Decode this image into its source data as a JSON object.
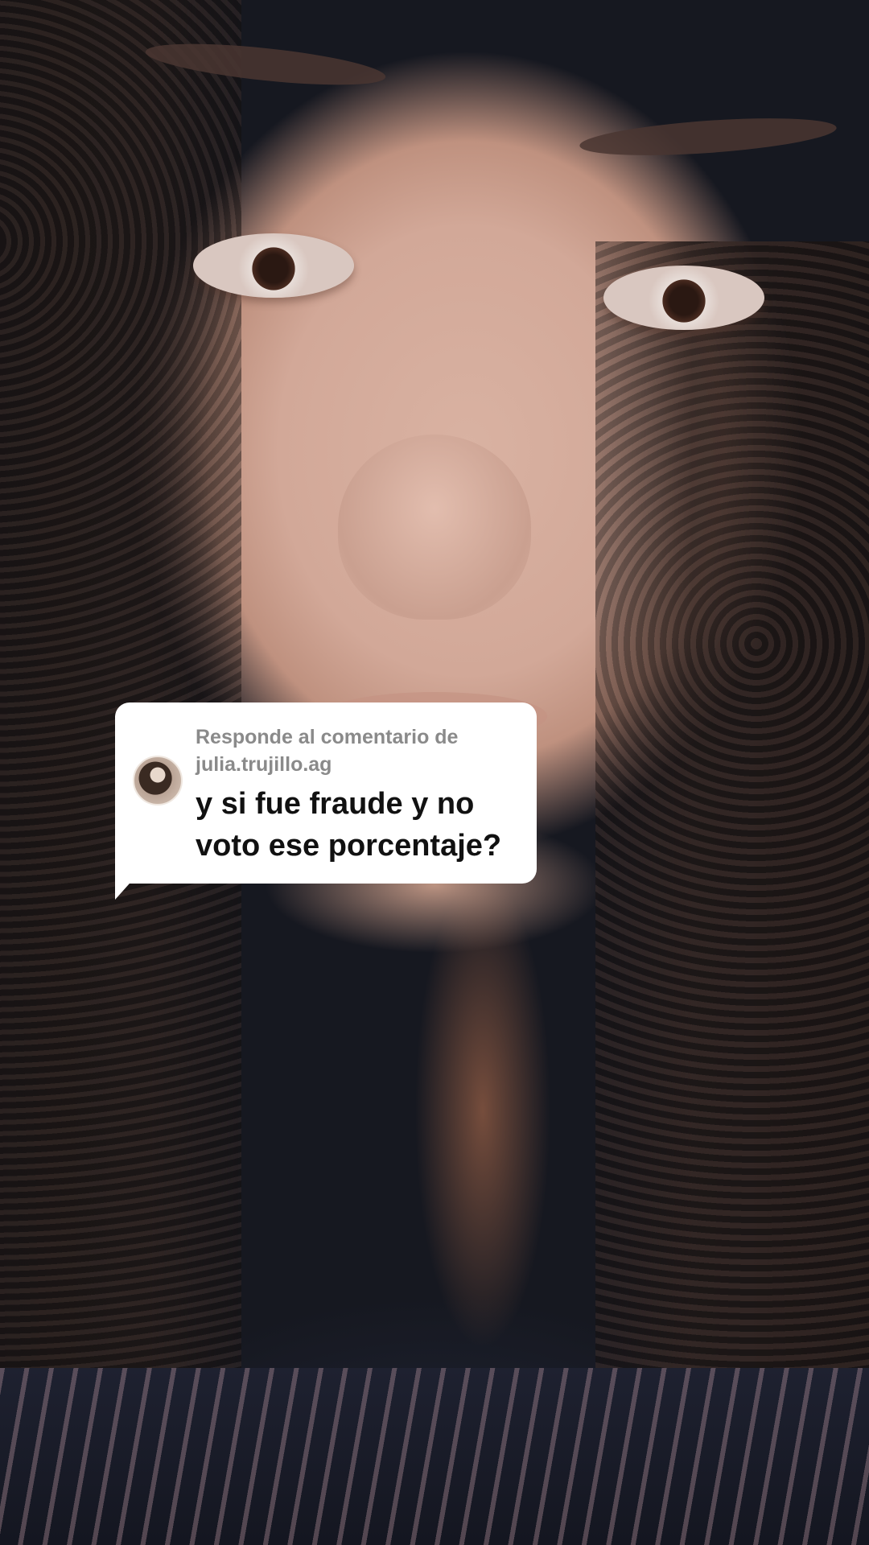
{
  "reply_sticker": {
    "header_line1": "Responde al comentario de",
    "username": "julia.trujillo.ag",
    "comment": "y si fue fraude y no voto ese porcentaje?",
    "avatar_icon": "user-avatar",
    "background_color": "#ffffff",
    "header_color": "#8a8a8a",
    "text_color": "#111111"
  },
  "video": {
    "content": "selfie-video-frame"
  }
}
